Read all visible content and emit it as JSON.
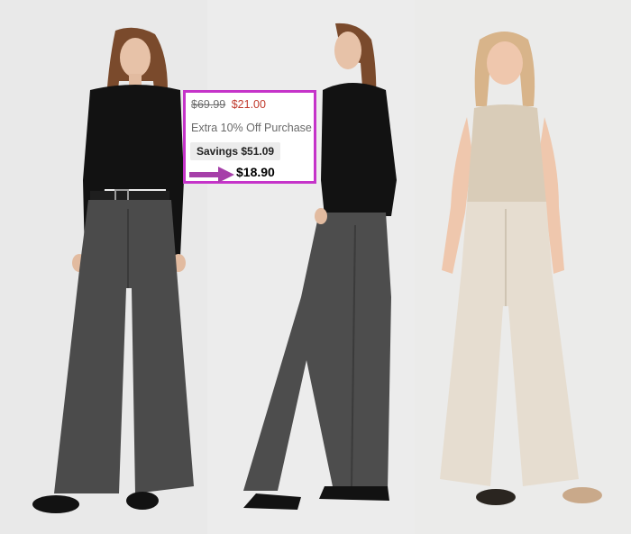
{
  "price_box": {
    "original_price": "$69.99",
    "sale_price": "$21.00",
    "promo": "Extra 10% Off Purchase",
    "savings": "Savings $51.09",
    "final_price": "$18.90"
  },
  "colors": {
    "highlight_border": "#c534c9",
    "arrow": "#a63fa9",
    "sale_price": "#c0392b"
  },
  "icons": [
    "arrow-right-icon"
  ],
  "photos": [
    "black-top-grey-jeans-front",
    "black-top-grey-jeans-side",
    "beige-top-white-jeans-front"
  ]
}
